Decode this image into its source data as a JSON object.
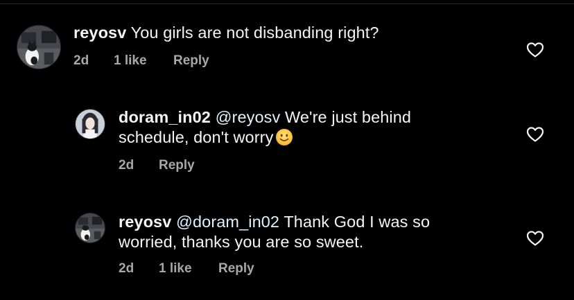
{
  "comments": [
    {
      "username": "reyosv",
      "mention": "",
      "text": "You girls are not disbanding right?",
      "time": "2d",
      "likes": "1 like",
      "reply_label": "Reply",
      "avatar_icon": "cat-photo-avatar",
      "like_icon": "heart-outline-icon"
    },
    {
      "username": "doram_in02",
      "mention": "@reyosv",
      "text_line1": "We're just behind",
      "text_line2": "schedule, don't worry",
      "emoji_icon": "slightly-smiling-face-emoji",
      "time": "2d",
      "reply_label": "Reply",
      "avatar_icon": "woman-portrait-avatar",
      "like_icon": "heart-outline-icon"
    },
    {
      "username": "reyosv",
      "mention": "@doram_in02",
      "text_line1": "Thank God I was so",
      "text_line2": "worried, thanks you are so sweet.",
      "time": "2d",
      "likes": "1 like",
      "reply_label": "Reply",
      "avatar_icon": "cat-photo-avatar",
      "like_icon": "heart-outline-icon"
    }
  ],
  "colors": {
    "background": "#000000",
    "primary_text": "#f5f5f5",
    "secondary_text": "#a8a8a8",
    "mention": "#e0f1ff",
    "divider": "#2a2a2a"
  }
}
